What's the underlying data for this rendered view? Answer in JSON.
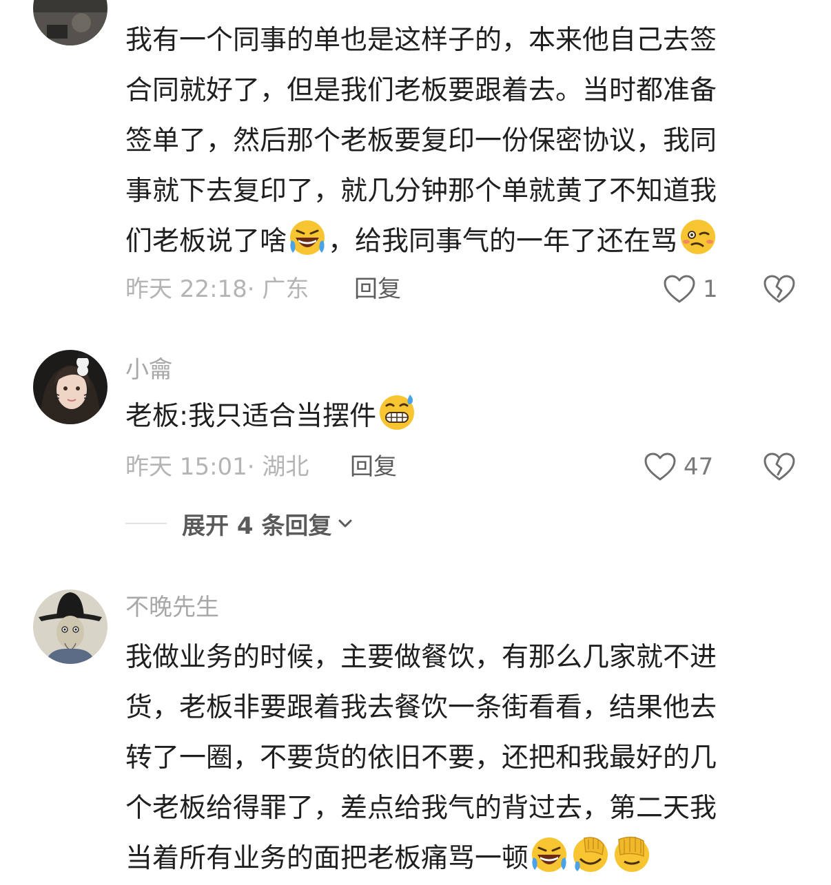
{
  "comments": [
    {
      "username": "",
      "lines": [
        "我有一个同事的单也是这样子的，本来他自己去签",
        "合同就好了，但是我们老板要跟着去。当时都准备",
        "签单了，然后那个老板要复印一份保密协议，我同",
        "事就下去复印了，就几分钟那个单就黄了不知道我"
      ],
      "last_line_a": "们老板说了啥",
      "last_line_b": "，给我同事气的一年了还在骂",
      "time_location": "昨天 22:18· 广东",
      "reply_label": "回复",
      "like_count": "1"
    },
    {
      "username": "小龠",
      "text": "老板:我只适合当摆件",
      "time_location": "昨天 15:01· 湖北",
      "reply_label": "回复",
      "like_count": "47",
      "expand_label": "展开 4 条回复"
    },
    {
      "username": "不晚先生",
      "lines": [
        "我做业务的时候，主要做餐饮，有那么几家就不进",
        "货，老板非要跟着我去餐饮一条街看看，结果他去",
        "转了一圈，不要货的依旧不要，还把和我最好的几",
        "个老板给得罪了，差点给我气的背过去，第二天我"
      ],
      "last_line": "当着所有业务的面把老板痛骂一顿"
    }
  ],
  "icons": {
    "like": "heart-outline-icon",
    "dislike": "broken-heart-icon",
    "expand": "chevron-down-icon",
    "emoji_1": "rofl-crying-laughing-emoji",
    "emoji_2": "woozy-face-emoji",
    "emoji_3": "grimacing-sweat-emoji",
    "emoji_4": "facepalm-emoji"
  },
  "colors": {
    "text": "#1f1f1f",
    "meta": "#b4b4b4",
    "username": "#a8a8a8",
    "reply": "#5c5c5c",
    "emoji_yellow": "#f7c531"
  }
}
